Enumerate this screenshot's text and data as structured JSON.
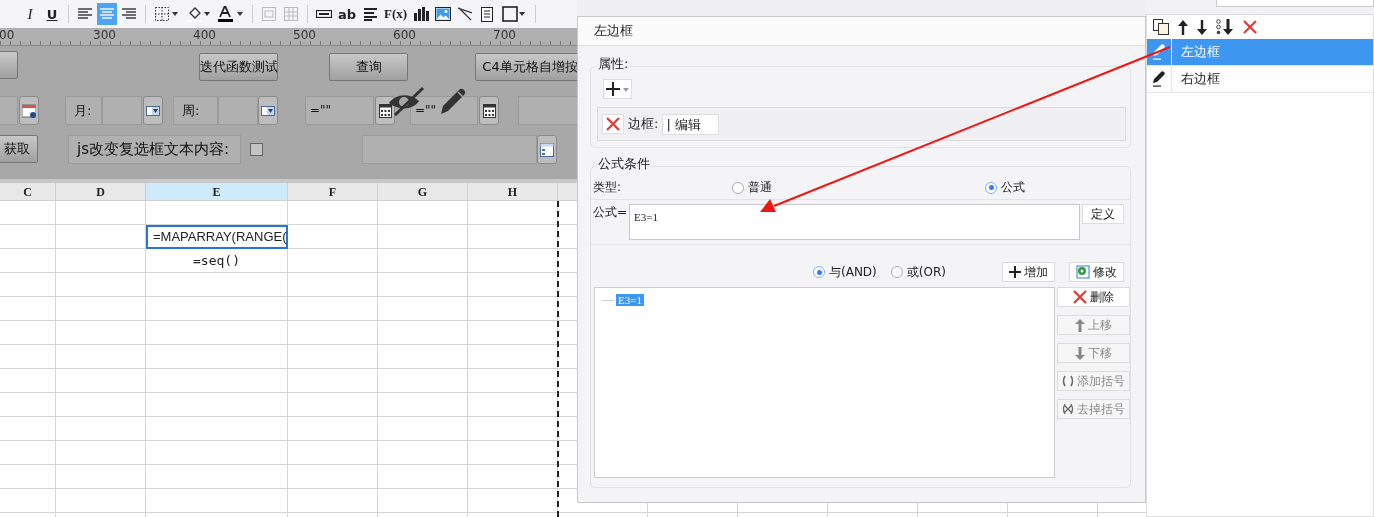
{
  "toolbar": {
    "italic": "I",
    "underline": "U",
    "alignment": [
      {
        "selected": false
      },
      {
        "selected": true
      },
      {
        "selected": false
      }
    ],
    "text_widget": "ab",
    "formula": "F(x)"
  },
  "ruler": {
    "labels": [
      "00",
      "300",
      "400",
      "500",
      "600",
      "700"
    ]
  },
  "form": {
    "buttons": [
      "迭代函数测试",
      "查询",
      "C4单元格自增按"
    ],
    "date_labels": [
      "月:",
      "周:"
    ],
    "formula_fields": [
      "=\"\"",
      "=\"\""
    ],
    "fetch_button": "获取",
    "checkbox_label": "js改变复选框文本内容:",
    "checkbox": {
      "checked": false
    }
  },
  "sheet": {
    "columns": [
      {
        "label": "C",
        "selected": false
      },
      {
        "label": "D",
        "selected": false
      },
      {
        "label": "E",
        "selected": true,
        "cells": [
          {
            "text": "=MAPARRAY(RANGE(",
            "selected": true
          },
          {
            "text": "=seq()",
            "selected": false
          }
        ]
      },
      {
        "label": "F",
        "selected": false
      },
      {
        "label": "G",
        "selected": false
      },
      {
        "label": "H",
        "selected": false
      }
    ]
  },
  "dialog": {
    "title": "左边框",
    "properties": {
      "title": "属性:",
      "border_label": "边框:",
      "border_value": "| 编辑"
    },
    "condition": {
      "title": "公式条件",
      "type_label": "类型:",
      "types": [
        {
          "label": "普通",
          "selected": false
        },
        {
          "label": "公式",
          "selected": true
        }
      ],
      "formula_label": "公式=",
      "formula_value": "E3=1",
      "define_button": "定义",
      "logic": [
        {
          "label": "与(AND)",
          "selected": true
        },
        {
          "label": "或(OR)",
          "selected": false
        }
      ],
      "add_button": "增加",
      "modify_button": "修改",
      "conditions": [
        {
          "text": "E3=1",
          "selected": true
        }
      ],
      "actions": [
        {
          "kind": "delete",
          "label": "删除",
          "disabled": false
        },
        {
          "kind": "up",
          "label": "上移",
          "disabled": true
        },
        {
          "kind": "down",
          "label": "下移",
          "disabled": true
        },
        {
          "kind": "add-brackets",
          "label": "添加括号",
          "disabled": true
        },
        {
          "kind": "remove-brackets",
          "label": "去掉括号",
          "disabled": true
        }
      ]
    }
  },
  "side_panel": {
    "items": [
      {
        "label": "左边框",
        "selected": true
      },
      {
        "label": "右边框",
        "selected": false
      }
    ]
  }
}
